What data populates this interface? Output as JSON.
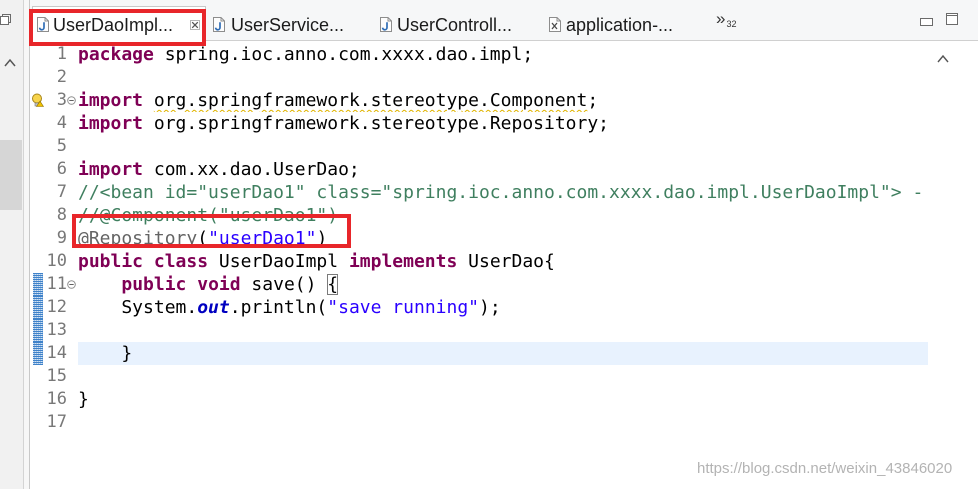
{
  "left_panel": {
    "icons": [
      "restore-icon",
      "chevron-up-icon"
    ]
  },
  "tabs": [
    {
      "label": "UserDaoImpl...",
      "icon": "java-file-icon",
      "active": true,
      "closable": true
    },
    {
      "label": "UserService...",
      "icon": "java-file-icon",
      "active": false,
      "closable": false
    },
    {
      "label": "UserControll...",
      "icon": "java-file-icon",
      "active": false,
      "closable": false
    },
    {
      "label": "application-...",
      "icon": "xml-file-icon",
      "active": false,
      "closable": false
    }
  ],
  "tab_overflow": {
    "symbol": "»",
    "hidden_count": "32"
  },
  "window_controls": {
    "icons": [
      "minimize-icon",
      "maximize-icon"
    ]
  },
  "right_ruler": {
    "icons": [
      "chevron-up-icon"
    ]
  },
  "syntax_colors": {
    "keyword": "#7f0055",
    "plain": "#000000",
    "comment": "#3f7f5f",
    "string": "#2a00ff",
    "annotation": "#646464",
    "field": "#0000c0"
  },
  "editor": {
    "current_line_color": "#e8f2fe",
    "lines": [
      {
        "n": "1",
        "tokens": [
          {
            "keyword": "package"
          },
          {
            "plain": " spring.ioc.anno.com.xxxx.dao.impl;"
          }
        ]
      },
      {
        "n": "2",
        "tokens": []
      },
      {
        "n": "3",
        "warning_marker": true,
        "fold": true,
        "tokens": [
          {
            "keyword": "import"
          },
          {
            "plain": " "
          },
          {
            "plain": "org.springframework.stereotype.Component",
            "squiggle": true
          },
          {
            "plain": ";"
          }
        ]
      },
      {
        "n": "4",
        "tokens": [
          {
            "keyword": "import"
          },
          {
            "plain": " org.springframework.stereotype.Repository;"
          }
        ]
      },
      {
        "n": "5",
        "tokens": []
      },
      {
        "n": "6",
        "tokens": [
          {
            "keyword": "import"
          },
          {
            "plain": " com.xx.dao.UserDao;"
          }
        ]
      },
      {
        "n": "7",
        "tokens": [
          {
            "comment": "//<bean id=\"userDao1\" class=\"spring.ioc.anno.com.xxxx.dao.impl.UserDaoImpl\"> -"
          }
        ]
      },
      {
        "n": "8",
        "tokens": [
          {
            "comment": "//@Component(\"userDao1\")"
          }
        ]
      },
      {
        "n": "9",
        "tokens": [
          {
            "annotation": "@Repository"
          },
          {
            "plain": "("
          },
          {
            "string": "\"userDao1\""
          },
          {
            "plain": ")"
          }
        ]
      },
      {
        "n": "10",
        "tokens": [
          {
            "keyword": "public"
          },
          {
            "plain": " "
          },
          {
            "keyword": "class"
          },
          {
            "plain": " UserDaoImpl "
          },
          {
            "keyword": "implements"
          },
          {
            "plain": " UserDao{"
          }
        ]
      },
      {
        "n": "11",
        "fold": true,
        "changed": true,
        "tokens": [
          {
            "plain": "    "
          },
          {
            "keyword": "public"
          },
          {
            "plain": " "
          },
          {
            "keyword": "void"
          },
          {
            "plain": " save() "
          },
          {
            "plain": "{",
            "bracket_match": true
          }
        ]
      },
      {
        "n": "12",
        "changed": true,
        "tokens": [
          {
            "plain": "    System."
          },
          {
            "field": "out"
          },
          {
            "plain": ".println("
          },
          {
            "string": "\"save running\""
          },
          {
            "plain": ");"
          }
        ]
      },
      {
        "n": "13",
        "changed": true,
        "tokens": []
      },
      {
        "n": "14",
        "changed": true,
        "current": true,
        "tokens": [
          {
            "plain": "    }"
          }
        ]
      },
      {
        "n": "15",
        "tokens": []
      },
      {
        "n": "16",
        "tokens": [
          {
            "plain": "}"
          }
        ]
      },
      {
        "n": "17",
        "tokens": []
      }
    ]
  },
  "highlight_box_color": "#e8262a",
  "watermark": "https://blog.csdn.net/weixin_43846020"
}
